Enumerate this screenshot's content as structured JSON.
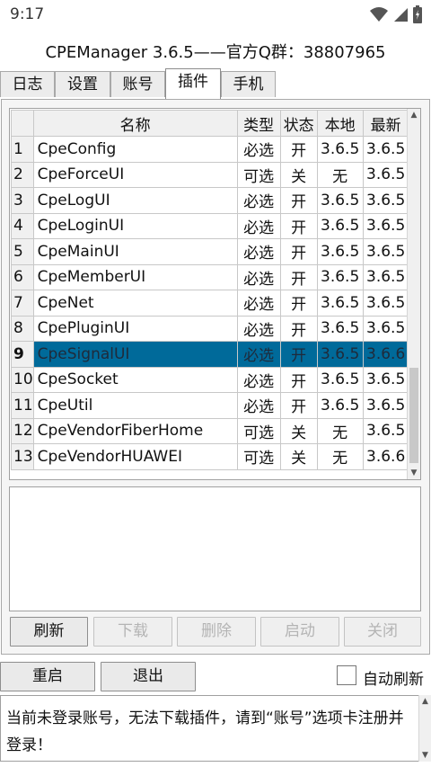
{
  "status_bar": {
    "time": "9:17"
  },
  "title": "CPEManager 3.6.5——官方Q群：38807965",
  "tabs": [
    {
      "label": "日志"
    },
    {
      "label": "设置"
    },
    {
      "label": "账号"
    },
    {
      "label": "插件",
      "active": true
    },
    {
      "label": "手机"
    }
  ],
  "table": {
    "headers": {
      "name": "名称",
      "type": "类型",
      "state": "状态",
      "local": "本地",
      "latest": "最新"
    },
    "rows": [
      {
        "num": "1",
        "name": "CpeConfig",
        "type": "必选",
        "state": "开",
        "local": "3.6.5",
        "latest": "3.6.5"
      },
      {
        "num": "2",
        "name": "CpeForceUI",
        "type": "可选",
        "state": "关",
        "local": "无",
        "latest": "3.6.5"
      },
      {
        "num": "3",
        "name": "CpeLogUI",
        "type": "必选",
        "state": "开",
        "local": "3.6.5",
        "latest": "3.6.5"
      },
      {
        "num": "4",
        "name": "CpeLoginUI",
        "type": "必选",
        "state": "开",
        "local": "3.6.5",
        "latest": "3.6.5"
      },
      {
        "num": "5",
        "name": "CpeMainUI",
        "type": "必选",
        "state": "开",
        "local": "3.6.5",
        "latest": "3.6.5"
      },
      {
        "num": "6",
        "name": "CpeMemberUI",
        "type": "必选",
        "state": "开",
        "local": "3.6.5",
        "latest": "3.6.5"
      },
      {
        "num": "7",
        "name": "CpeNet",
        "type": "必选",
        "state": "开",
        "local": "3.6.5",
        "latest": "3.6.5"
      },
      {
        "num": "8",
        "name": "CpePluginUI",
        "type": "必选",
        "state": "开",
        "local": "3.6.5",
        "latest": "3.6.5"
      },
      {
        "num": "9",
        "name": "CpeSignalUI",
        "type": "必选",
        "state": "开",
        "local": "3.6.5",
        "latest": "3.6.6",
        "selected": true
      },
      {
        "num": "10",
        "name": "CpeSocket",
        "type": "必选",
        "state": "开",
        "local": "3.6.5",
        "latest": "3.6.5"
      },
      {
        "num": "11",
        "name": "CpeUtil",
        "type": "必选",
        "state": "开",
        "local": "3.6.5",
        "latest": "3.6.5"
      },
      {
        "num": "12",
        "name": "CpeVendorFiberHome",
        "type": "可选",
        "state": "关",
        "local": "无",
        "latest": "3.6.5"
      },
      {
        "num": "13",
        "name": "CpeVendorHUAWEI",
        "type": "可选",
        "state": "关",
        "local": "无",
        "latest": "3.6.6"
      }
    ]
  },
  "plugin_buttons": {
    "refresh": "刷新",
    "download": "下载",
    "delete": "删除",
    "start": "启动",
    "close": "关闭"
  },
  "bottom_buttons": {
    "restart": "重启",
    "exit": "退出",
    "auto_refresh": "自动刷新"
  },
  "log_message": "当前未登录账号，无法下载插件，请到“账号”选项卡注册并登录！",
  "colors": {
    "selected_row": "#006a9a"
  }
}
